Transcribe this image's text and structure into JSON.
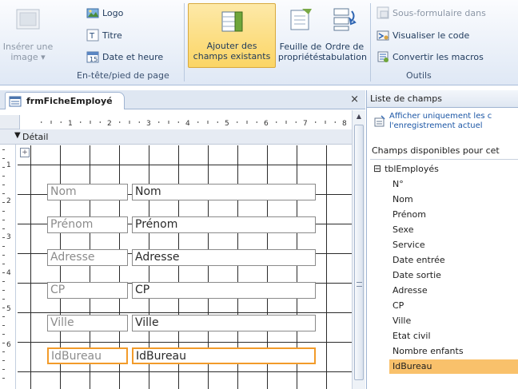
{
  "ribbon": {
    "insert_image_label": "Insérer une",
    "insert_image_label2": "image",
    "logo_label": "Logo",
    "title_label": "Titre",
    "datetime_label": "Date et heure",
    "header_group_label": "En-tête/pied de page",
    "add_fields_label": "Ajouter des",
    "add_fields_label2": "champs existants",
    "property_sheet_label": "Feuille de",
    "property_sheet_label2": "propriétés",
    "tab_order_label": "Ordre de",
    "tab_order_label2": "tabulation",
    "subform_label": "Sous-formulaire dans",
    "view_code_label": "Visualiser le code",
    "convert_macros_label": "Convertir les macros",
    "tools_group_label": "Outils"
  },
  "document": {
    "tab_title": "frmFicheEmployé",
    "close_symbol": "×",
    "section_label": "Détail",
    "ruler_marks": [
      "1",
      "2",
      "3",
      "4",
      "5",
      "6",
      "7",
      "8"
    ],
    "vruler_marks": [
      "1",
      "2",
      "3",
      "4",
      "5",
      "6"
    ],
    "controls": [
      {
        "label": "Nom",
        "text": "Nom"
      },
      {
        "label": "Prénom",
        "text": "Prénom"
      },
      {
        "label": "Adresse",
        "text": "Adresse"
      },
      {
        "label": "CP",
        "text": "CP"
      },
      {
        "label": "Ville",
        "text": "Ville"
      },
      {
        "label": "IdBureau",
        "text": "IdBureau"
      }
    ]
  },
  "field_list": {
    "title": "Liste de champs",
    "filter_line1": "Afficher uniquement les c",
    "filter_line2": "l'enregistrement actuel",
    "available_label": "Champs disponibles pour cet",
    "table_toggle": "⊟",
    "table_name": "tblEmployés",
    "fields": [
      "N°",
      "Nom",
      "Prénom",
      "Sexe",
      "Service",
      "Date entrée",
      "Date sortie",
      "Adresse",
      "CP",
      "Ville",
      "Etat civil",
      "Nombre enfants",
      "IdBureau"
    ],
    "selected_field": "IdBureau"
  },
  "colors": {
    "accent": "#f29b2a",
    "selected_field_bg": "#f9c16b",
    "ribbon_active": "#fbd565",
    "link": "#1b56a5"
  }
}
